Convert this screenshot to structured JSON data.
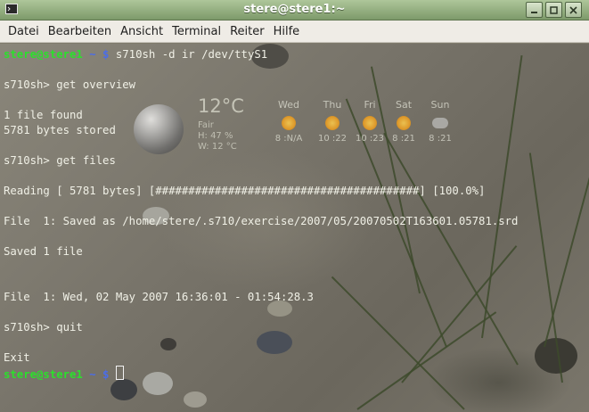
{
  "window": {
    "title": "stere@stere1:~",
    "icons": {
      "app": "terminal-icon",
      "minimize": "minimize-icon",
      "maximize": "maximize-icon",
      "close": "close-icon"
    }
  },
  "menubar": {
    "items": [
      {
        "label": "Datei"
      },
      {
        "label": "Bearbeiten"
      },
      {
        "label": "Ansicht"
      },
      {
        "label": "Terminal"
      },
      {
        "label": "Reiter"
      },
      {
        "label": "Hilfe"
      }
    ]
  },
  "weather": {
    "temperature": "12°C",
    "condition": "Fair",
    "humidity": "H: 47 %",
    "wind": "W: 12 °C",
    "days": [
      {
        "name": "Wed",
        "icon": "partly-cloudy-icon",
        "value": "8 :N/A"
      },
      {
        "name": "Thu",
        "icon": "sun-icon",
        "value": "10 :22"
      },
      {
        "name": "Fri",
        "icon": "sun-icon",
        "value": "10 :23"
      },
      {
        "name": "Sat",
        "icon": "sun-icon",
        "value": "8 :21"
      },
      {
        "name": "Sun",
        "icon": "cloud-icon",
        "value": "8 :21"
      }
    ]
  },
  "terminal": {
    "colors": {
      "user": "#2ce02c",
      "symbol": "#4b6de8",
      "text": "#f0f0e6"
    },
    "prompt_user": "stere@stere1",
    "prompt_sep": " ~ $ ",
    "lines": [
      {
        "kind": "prompt",
        "text": "s710sh -d ir /dev/ttyS1"
      },
      {
        "kind": "blank",
        "text": ""
      },
      {
        "kind": "out",
        "text": "s710sh> get overview"
      },
      {
        "kind": "blank",
        "text": ""
      },
      {
        "kind": "out",
        "text": "1 file found"
      },
      {
        "kind": "out",
        "text": "5781 bytes stored"
      },
      {
        "kind": "blank",
        "text": ""
      },
      {
        "kind": "out",
        "text": "s710sh> get files"
      },
      {
        "kind": "blank",
        "text": ""
      },
      {
        "kind": "out",
        "text": "Reading [ 5781 bytes] [########################################] [100.0%]"
      },
      {
        "kind": "blank",
        "text": ""
      },
      {
        "kind": "out",
        "text": "File  1: Saved as /home/stere/.s710/exercise/2007/05/20070502T163601.05781.srd"
      },
      {
        "kind": "blank",
        "text": ""
      },
      {
        "kind": "out",
        "text": "Saved 1 file"
      },
      {
        "kind": "blank",
        "text": ""
      },
      {
        "kind": "blank",
        "text": ""
      },
      {
        "kind": "out",
        "text": "File  1: Wed, 02 May 2007 16:36:01 - 01:54:28.3"
      },
      {
        "kind": "blank",
        "text": ""
      },
      {
        "kind": "out",
        "text": "s710sh> quit"
      },
      {
        "kind": "blank",
        "text": ""
      },
      {
        "kind": "out",
        "text": "Exit"
      },
      {
        "kind": "prompt",
        "text": ""
      }
    ]
  }
}
